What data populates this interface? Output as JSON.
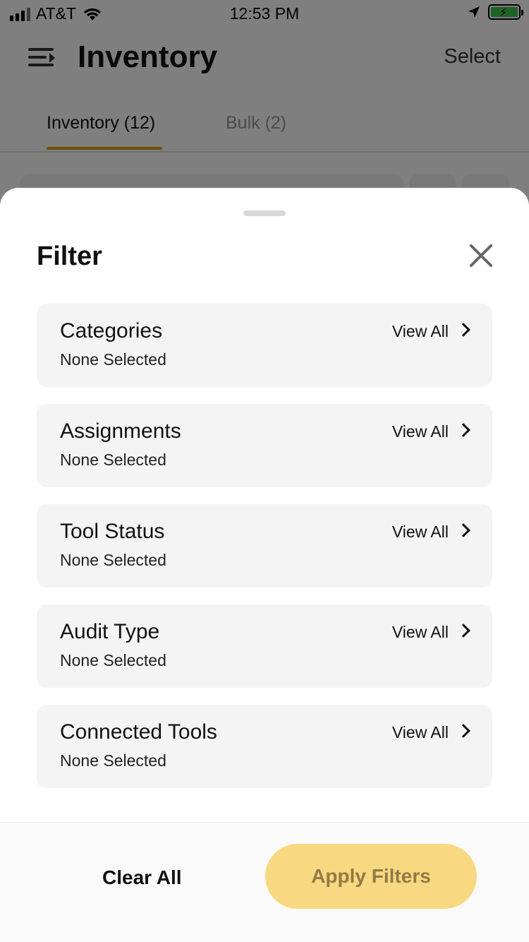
{
  "status_bar": {
    "carrier": "AT&T",
    "time": "12:53 PM"
  },
  "header": {
    "title": "Inventory",
    "select_label": "Select"
  },
  "tabs": [
    {
      "label": "Inventory (12)",
      "active": true
    },
    {
      "label": "Bulk (2)",
      "active": false
    }
  ],
  "sheet": {
    "title": "Filter",
    "filters": [
      {
        "title": "Categories",
        "value": "None Selected",
        "action": "View All"
      },
      {
        "title": "Assignments",
        "value": "None Selected",
        "action": "View All"
      },
      {
        "title": "Tool Status",
        "value": "None Selected",
        "action": "View All"
      },
      {
        "title": "Audit Type",
        "value": "None Selected",
        "action": "View All"
      },
      {
        "title": "Connected Tools",
        "value": "None Selected",
        "action": "View All"
      }
    ],
    "footer": {
      "clear_label": "Clear All",
      "apply_label": "Apply Filters"
    }
  },
  "colors": {
    "accent": "#e3a500",
    "apply_button_bg": "#f8d982",
    "apply_button_text": "#937a44",
    "card_bg": "#f4f4f4"
  }
}
